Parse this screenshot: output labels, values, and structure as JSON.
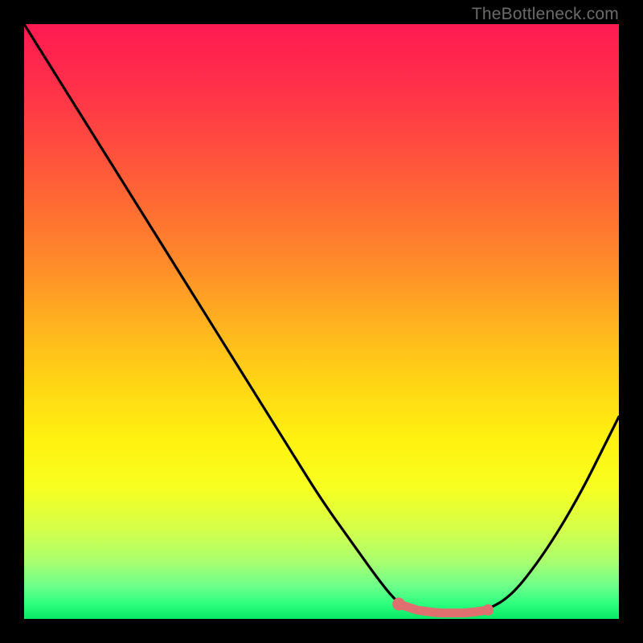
{
  "watermark": "TheBottleneck.com",
  "gradient": {
    "stops": [
      {
        "offset": 0.0,
        "color": "#ff1a52"
      },
      {
        "offset": 0.1,
        "color": "#ff2f4a"
      },
      {
        "offset": 0.2,
        "color": "#ff4b3f"
      },
      {
        "offset": 0.3,
        "color": "#ff6a33"
      },
      {
        "offset": 0.4,
        "color": "#ff8a2a"
      },
      {
        "offset": 0.5,
        "color": "#ffb11f"
      },
      {
        "offset": 0.6,
        "color": "#ffd415"
      },
      {
        "offset": 0.7,
        "color": "#fff210"
      },
      {
        "offset": 0.78,
        "color": "#f7ff20"
      },
      {
        "offset": 0.85,
        "color": "#d4ff4a"
      },
      {
        "offset": 0.905,
        "color": "#a8ff70"
      },
      {
        "offset": 0.945,
        "color": "#6cff8a"
      },
      {
        "offset": 0.975,
        "color": "#2dff7e"
      },
      {
        "offset": 1.0,
        "color": "#08e765"
      }
    ]
  },
  "marker_color": "#e06f6f",
  "chart_data": {
    "type": "line",
    "title": "",
    "xlabel": "",
    "ylabel": "",
    "xlim": [
      0,
      100
    ],
    "ylim": [
      0,
      100
    ],
    "series": [
      {
        "name": "bottleneck-curve",
        "x": [
          0,
          5,
          10,
          15,
          20,
          25,
          30,
          35,
          40,
          45,
          50,
          55,
          60,
          63,
          66,
          70,
          74,
          78,
          82,
          86,
          90,
          94,
          97,
          100
        ],
        "y": [
          100,
          92,
          84,
          76,
          68,
          60,
          52,
          44,
          36,
          28,
          20,
          13,
          6,
          2.5,
          1,
          1,
          1,
          1.5,
          4,
          9,
          15,
          22,
          28,
          34
        ]
      }
    ],
    "markers": {
      "name": "optimal-band",
      "x": [
        63,
        64.5,
        66,
        68,
        70,
        72,
        74,
        76,
        78
      ],
      "y": [
        2.5,
        2,
        1.5,
        1.2,
        1.0,
        1.0,
        1.0,
        1.2,
        1.5
      ]
    }
  }
}
